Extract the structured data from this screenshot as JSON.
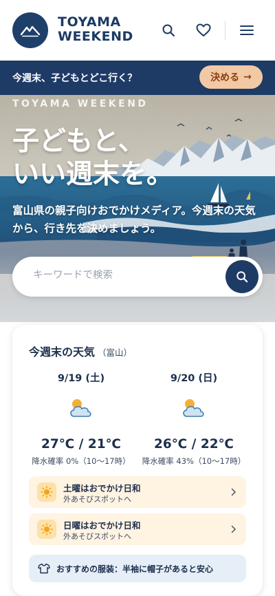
{
  "header": {
    "brand_line1": "TOYAMA",
    "brand_line2": "WEEKEND",
    "icons": [
      "mountain-logo-icon",
      "search-icon",
      "heart-icon",
      "menu-icon"
    ]
  },
  "promo": {
    "text": "今週末、子どもとどこ行く？",
    "button_label": "決める",
    "button_arrow": "→"
  },
  "hero": {
    "kicker": "TOYAMA WEEKEND",
    "title_line1": "子どもと、",
    "title_line2": "いい週末を。",
    "subtitle": "富山県の親子向けおでかけメディア。今週末の天気から、行き先を決めましょう。"
  },
  "search": {
    "placeholder": "キーワードで検索",
    "value": ""
  },
  "weather": {
    "title": "今週末の天気",
    "location": "（富山）",
    "days": [
      {
        "date": "9/19 (土)",
        "icon": "partly-cloudy-icon",
        "temp": "27℃ / 21℃",
        "rain": "降水確率 0%（10〜17時）"
      },
      {
        "date": "9/20 (日)",
        "icon": "partly-cloudy-icon",
        "temp": "26℃ / 22℃",
        "rain": "降水確率 43%（10〜17時）"
      }
    ],
    "suggestions": [
      {
        "title": "土曜はおでかけ日和",
        "sub": "外あそびスポットへ"
      },
      {
        "title": "日曜はおでかけ日和",
        "sub": "外あそびスポットへ"
      }
    ],
    "outfit": "おすすめの服装：半袖に帽子があると安心"
  },
  "colors": {
    "navy": "#1e3b66",
    "promo_button": "#f2c9a4",
    "suggestion_bg": "#fff3e2",
    "outfit_bg": "#e6eef8"
  }
}
